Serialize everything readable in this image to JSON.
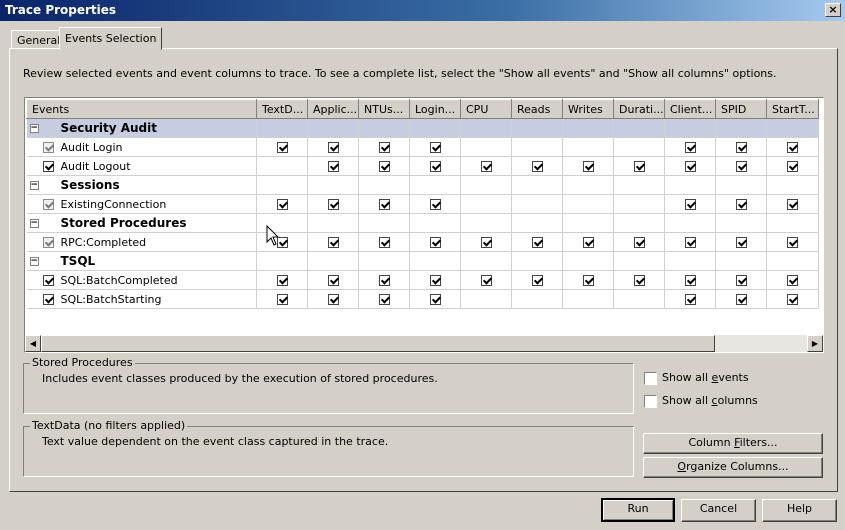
{
  "window": {
    "title": "Trace Properties",
    "close": "×"
  },
  "tabs": [
    {
      "label": "General"
    },
    {
      "label": "Events Selection"
    }
  ],
  "intro": "Review selected events and event columns to trace. To see a complete list, select the \"Show all events\" and \"Show all columns\" options.",
  "grid": {
    "columns": [
      "Events",
      "TextD...",
      "Applic...",
      "NTUs...",
      "Login...",
      "CPU",
      "Reads",
      "Writes",
      "Durati...",
      "Client...",
      "SPID",
      "StartT..."
    ],
    "rows": [
      {
        "type": "category",
        "label": "Security Audit",
        "selected": true
      },
      {
        "type": "event",
        "label": "Audit Login",
        "event_checked": "gray",
        "cells": [
          1,
          1,
          1,
          1,
          0,
          0,
          0,
          0,
          1,
          1,
          1
        ]
      },
      {
        "type": "event",
        "label": "Audit Logout",
        "event_checked": "on",
        "cells": [
          0,
          1,
          1,
          1,
          1,
          1,
          1,
          1,
          1,
          1,
          1
        ]
      },
      {
        "type": "category",
        "label": "Sessions"
      },
      {
        "type": "event",
        "label": "ExistingConnection",
        "event_checked": "gray",
        "cells": [
          1,
          1,
          1,
          1,
          0,
          0,
          0,
          0,
          1,
          1,
          1
        ]
      },
      {
        "type": "category",
        "label": "Stored Procedures"
      },
      {
        "type": "event",
        "label": "RPC:Completed",
        "event_checked": "gray",
        "cells": [
          1,
          1,
          1,
          1,
          1,
          1,
          1,
          1,
          1,
          1,
          1
        ]
      },
      {
        "type": "category",
        "label": "TSQL"
      },
      {
        "type": "event",
        "label": "SQL:BatchCompleted",
        "event_checked": "on",
        "cells": [
          1,
          1,
          1,
          1,
          1,
          1,
          1,
          1,
          1,
          1,
          1
        ]
      },
      {
        "type": "event",
        "label": "SQL:BatchStarting",
        "event_checked": "on",
        "cells": [
          1,
          1,
          1,
          1,
          0,
          0,
          0,
          0,
          1,
          1,
          1
        ]
      }
    ]
  },
  "event_group": {
    "legend": "Stored Procedures",
    "description": "Includes event classes produced by the execution of stored procedures."
  },
  "column_group": {
    "legend": "TextData (no filters applied)",
    "description": "Text value dependent on the event class captured in the trace."
  },
  "options": {
    "show_all_events": {
      "prefix": "Show all ",
      "accel": "e",
      "suffix": "vents"
    },
    "show_all_columns": {
      "prefix": "Show all ",
      "accel": "c",
      "suffix": "olumns"
    }
  },
  "buttons": {
    "column_filters": {
      "prefix": "Column ",
      "accel": "F",
      "suffix": "ilters..."
    },
    "organize_columns": {
      "accel": "O",
      "suffix": "rganize Columns..."
    },
    "run": "Run",
    "cancel": "Cancel",
    "help": "Help"
  }
}
